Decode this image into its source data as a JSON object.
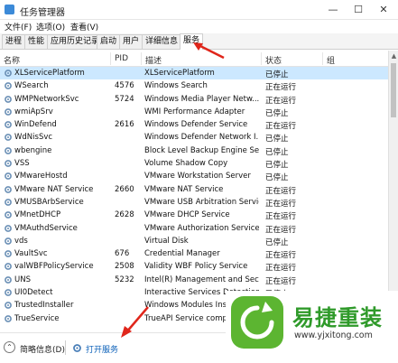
{
  "window": {
    "title": "任务管理器",
    "minimize": "—",
    "maximize": "☐",
    "close": "✕"
  },
  "menu": [
    "文件(F)",
    "选项(O)",
    "查看(V)"
  ],
  "tabs": [
    "进程",
    "性能",
    "应用历史记录",
    "启动",
    "用户",
    "详细信息",
    "服务"
  ],
  "active_tab": "服务",
  "columns": {
    "name": "名称",
    "pid": "PID",
    "desc": "描述",
    "status": "状态",
    "group": "组"
  },
  "services": [
    {
      "name": "XLServicePlatform",
      "pid": "",
      "desc": "XLServicePlatform",
      "status": "已停止"
    },
    {
      "name": "WSearch",
      "pid": "4576",
      "desc": "Windows Search",
      "status": "正在运行"
    },
    {
      "name": "WMPNetworkSvc",
      "pid": "5724",
      "desc": "Windows Media Player Netw...",
      "status": "正在运行"
    },
    {
      "name": "wmiApSrv",
      "pid": "",
      "desc": "WMI Performance Adapter",
      "status": "已停止"
    },
    {
      "name": "WinDefend",
      "pid": "2616",
      "desc": "Windows Defender Service",
      "status": "正在运行"
    },
    {
      "name": "WdNisSvc",
      "pid": "",
      "desc": "Windows Defender Network I...",
      "status": "已停止"
    },
    {
      "name": "wbengine",
      "pid": "",
      "desc": "Block Level Backup Engine Se...",
      "status": "已停止"
    },
    {
      "name": "VSS",
      "pid": "",
      "desc": "Volume Shadow Copy",
      "status": "已停止"
    },
    {
      "name": "VMwareHostd",
      "pid": "",
      "desc": "VMware Workstation Server",
      "status": "已停止"
    },
    {
      "name": "VMware NAT Service",
      "pid": "2660",
      "desc": "VMware NAT Service",
      "status": "正在运行"
    },
    {
      "name": "VMUSBArbService",
      "pid": "",
      "desc": "VMware USB Arbitration Service",
      "status": "正在运行"
    },
    {
      "name": "VMnetDHCP",
      "pid": "2628",
      "desc": "VMware DHCP Service",
      "status": "正在运行"
    },
    {
      "name": "VMAuthdService",
      "pid": "",
      "desc": "VMware Authorization Service",
      "status": "正在运行"
    },
    {
      "name": "vds",
      "pid": "",
      "desc": "Virtual Disk",
      "status": "已停止"
    },
    {
      "name": "VaultSvc",
      "pid": "676",
      "desc": "Credential Manager",
      "status": "正在运行"
    },
    {
      "name": "valWBFPolicyService",
      "pid": "2508",
      "desc": "Validity WBF Policy Service",
      "status": "正在运行"
    },
    {
      "name": "UNS",
      "pid": "5232",
      "desc": "Intel(R) Management and Sec...",
      "status": "正在运行"
    },
    {
      "name": "UI0Detect",
      "pid": "",
      "desc": "Interactive Services Detection",
      "status": "已停止"
    },
    {
      "name": "TrustedInstaller",
      "pid": "",
      "desc": "Windows Modules Installer",
      "status": "已停止"
    },
    {
      "name": "TrueService",
      "pid": "",
      "desc": "TrueAPI Service component",
      "status": "已停止"
    }
  ],
  "footer": {
    "less_details": "简略信息(D)",
    "open_services": "打开服务"
  },
  "watermark": {
    "brand": "易捷重装",
    "url": "www.yjxitong.com"
  },
  "colors": {
    "selected_row": "#cce8ff",
    "link": "#0a5fb8",
    "arrow": "#e0261b",
    "brand_green": "#5cb531"
  }
}
